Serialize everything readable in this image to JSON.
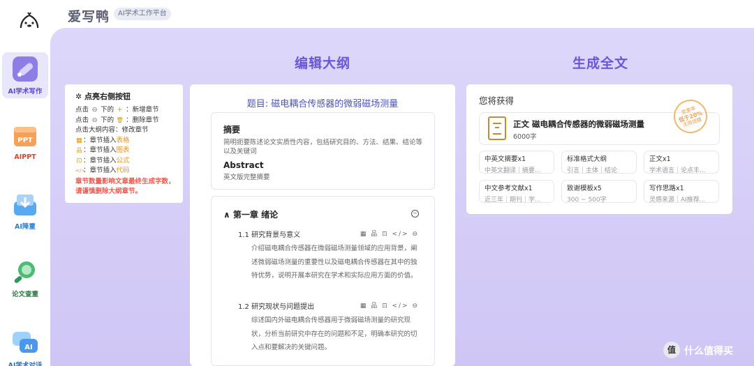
{
  "app": {
    "name": "爱写鸭",
    "tag": "AI学术工作平台"
  },
  "sidebar": {
    "items": [
      {
        "label": "AI学术写作",
        "icon": "pen-icon",
        "active": true
      },
      {
        "label": "AIPPT",
        "icon": "ppt-icon",
        "active": false
      },
      {
        "label": "AI降重",
        "icon": "download-tray-icon",
        "active": false
      },
      {
        "label": "论文查重",
        "icon": "magnifier-icon",
        "active": false
      },
      {
        "label": "AI学术对话",
        "icon": "chat-ai-icon",
        "active": false
      }
    ]
  },
  "sections": {
    "outline_title": "编辑大纲",
    "fulltext_title": "生成全文"
  },
  "hint": {
    "title": "点亮右侧按钮",
    "rows": [
      {
        "pre": "点击",
        "icon": "⊖",
        "mid": "下的",
        "icon2": "+",
        "post": "：新增章节"
      },
      {
        "pre": "点击",
        "icon": "⊖",
        "mid": "下的",
        "icon2": "🗑",
        "post": "：删除章节"
      }
    ],
    "edit_text": "点击大纲内容：修改章节",
    "inserts": [
      {
        "icon": "▦",
        "text": "：章节插入",
        "accent": "表格"
      },
      {
        "icon": "品",
        "text": "：章节插入",
        "accent": "图表"
      },
      {
        "icon": "⊡",
        "text": "：章节插入",
        "accent": "公式"
      },
      {
        "icon": "</>",
        "text": "：章节插入",
        "accent": "代码"
      }
    ],
    "warning": "章节数量影响文章最终生成字数，请谨慎删除大纲章节。"
  },
  "outline": {
    "title": "题目: 磁电耦合传感器的微弱磁场测量",
    "abstract_cn_heading": "摘要",
    "abstract_cn_text": "简明扼要陈述论文实质性内容，包括研究目的、方法、结果、结论等以及关键词",
    "abstract_en_heading": "Abstract",
    "abstract_en_text": "英文版完整摘要",
    "chapter_heading": "∧ 第一章  绪论",
    "sections": [
      {
        "heading": "1.1  研究背景与意义",
        "tools": "▦ 品 ⊡ </> ⊖",
        "body": "介绍磁电耦合传感器在微弱磁场测量领域的应用背景，阐述微弱磁场测量的重要性以及磁电耦合传感器在其中的独特优势，说明开展本研究在学术和实际应用方面的价值。"
      },
      {
        "heading": "1.2  研究现状与问题提出",
        "tools": "▦ 品 ⊡ </> ⊖",
        "body": "综述国内外磁电耦合传感器用于微弱磁场测量的研究现状，分析当前研究中存在的问题和不足，明确本研究的切入点和要解决的关键问题。"
      }
    ]
  },
  "gain": {
    "title": "您将获得",
    "main_item": {
      "title": "正文 磁电耦合传感器的微弱磁场测量",
      "sub": "6000字"
    },
    "stamp": {
      "line1": "查重率",
      "line2": "低于20%",
      "line3": "无限提醒"
    },
    "items": [
      {
        "title": "中英文摘要x1",
        "sub": "中英文翻译｜摘要..."
      },
      {
        "title": "标准格式大纲",
        "sub": "引言｜主体｜结论"
      },
      {
        "title": "正文x1",
        "sub": "学术语言｜论点丰..."
      },
      {
        "title": "中文参考文献x1",
        "sub": "近三年｜期刊｜学..."
      },
      {
        "title": "致谢模板x5",
        "sub": "300 ~ 500字"
      },
      {
        "title": "写作思路x1",
        "sub": "灵感来源｜AI推荐..."
      }
    ]
  },
  "watermark": {
    "badge": "值",
    "text": "什么值得买"
  },
  "colors": {
    "accent": "#6b57d6",
    "warning": "#ef5a4f",
    "insert_accent": "#e5962a"
  }
}
